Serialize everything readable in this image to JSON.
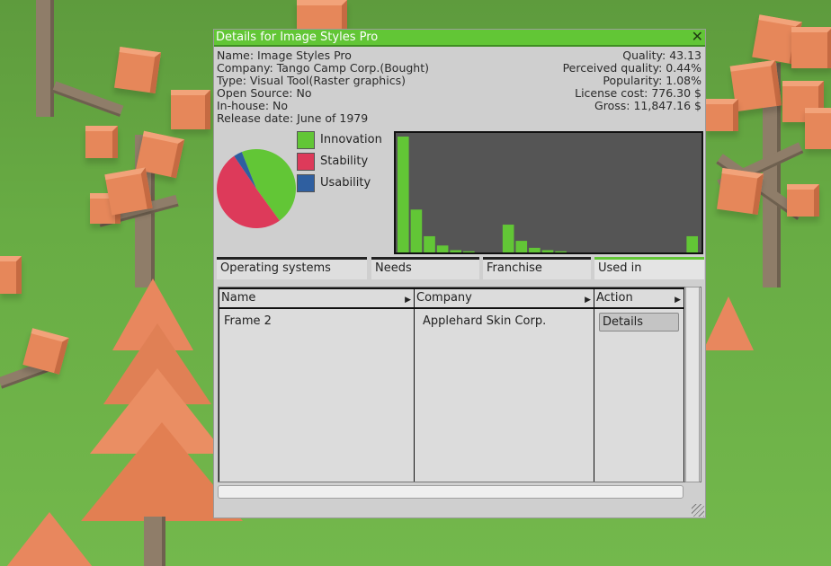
{
  "window": {
    "title": "Details for Image Styles Pro",
    "close_glyph": "✕"
  },
  "info_left": [
    "Name: Image Styles Pro",
    "Company: Tango Camp Corp.(Bought)",
    "Type: Visual Tool(Raster graphics)",
    "Open Source: No",
    "In-house: No",
    "Release date: June of 1979"
  ],
  "info_right": [
    "Quality: 43.13",
    "Perceived quality: 0.44%",
    "Popularity: 1.08%",
    "License cost: 776.30 $",
    "Gross: 11,847.16 $"
  ],
  "pie_chart": {
    "slices": [
      {
        "label": "Innovation",
        "value": 0.46,
        "color": "#62c636"
      },
      {
        "label": "Stability",
        "value": 0.505,
        "color": "#dd3a5a"
      },
      {
        "label": "Usability",
        "value": 0.035,
        "color": "#2f5fa0"
      }
    ]
  },
  "legend": [
    {
      "label": "Innovation",
      "color": "#62c636"
    },
    {
      "label": "Stability",
      "color": "#dd3a5a"
    },
    {
      "label": "Usability",
      "color": "#2f5fa0"
    }
  ],
  "chart_data": {
    "type": "bar",
    "bar_color": "#62c636",
    "background": "#555555",
    "values": [
      100,
      37,
      14,
      6,
      2,
      1,
      0,
      0,
      24,
      10,
      4,
      2,
      1,
      0,
      0,
      0,
      0,
      0,
      0,
      0,
      0,
      0,
      14
    ]
  },
  "tabs": [
    {
      "label": "Operating systems",
      "active": false
    },
    {
      "label": "Needs",
      "active": false
    },
    {
      "label": "Franchise",
      "active": false
    },
    {
      "label": "Used in",
      "active": true
    }
  ],
  "table": {
    "columns": [
      "Name",
      "Company",
      "Action"
    ],
    "rows": [
      {
        "name": "Frame 2",
        "company": "Applehard Skin Corp.",
        "action": "Details"
      }
    ]
  },
  "icons": {
    "column_sort": "sort-arrow-icon",
    "resize": "resize-grip-icon",
    "close": "close-icon"
  }
}
